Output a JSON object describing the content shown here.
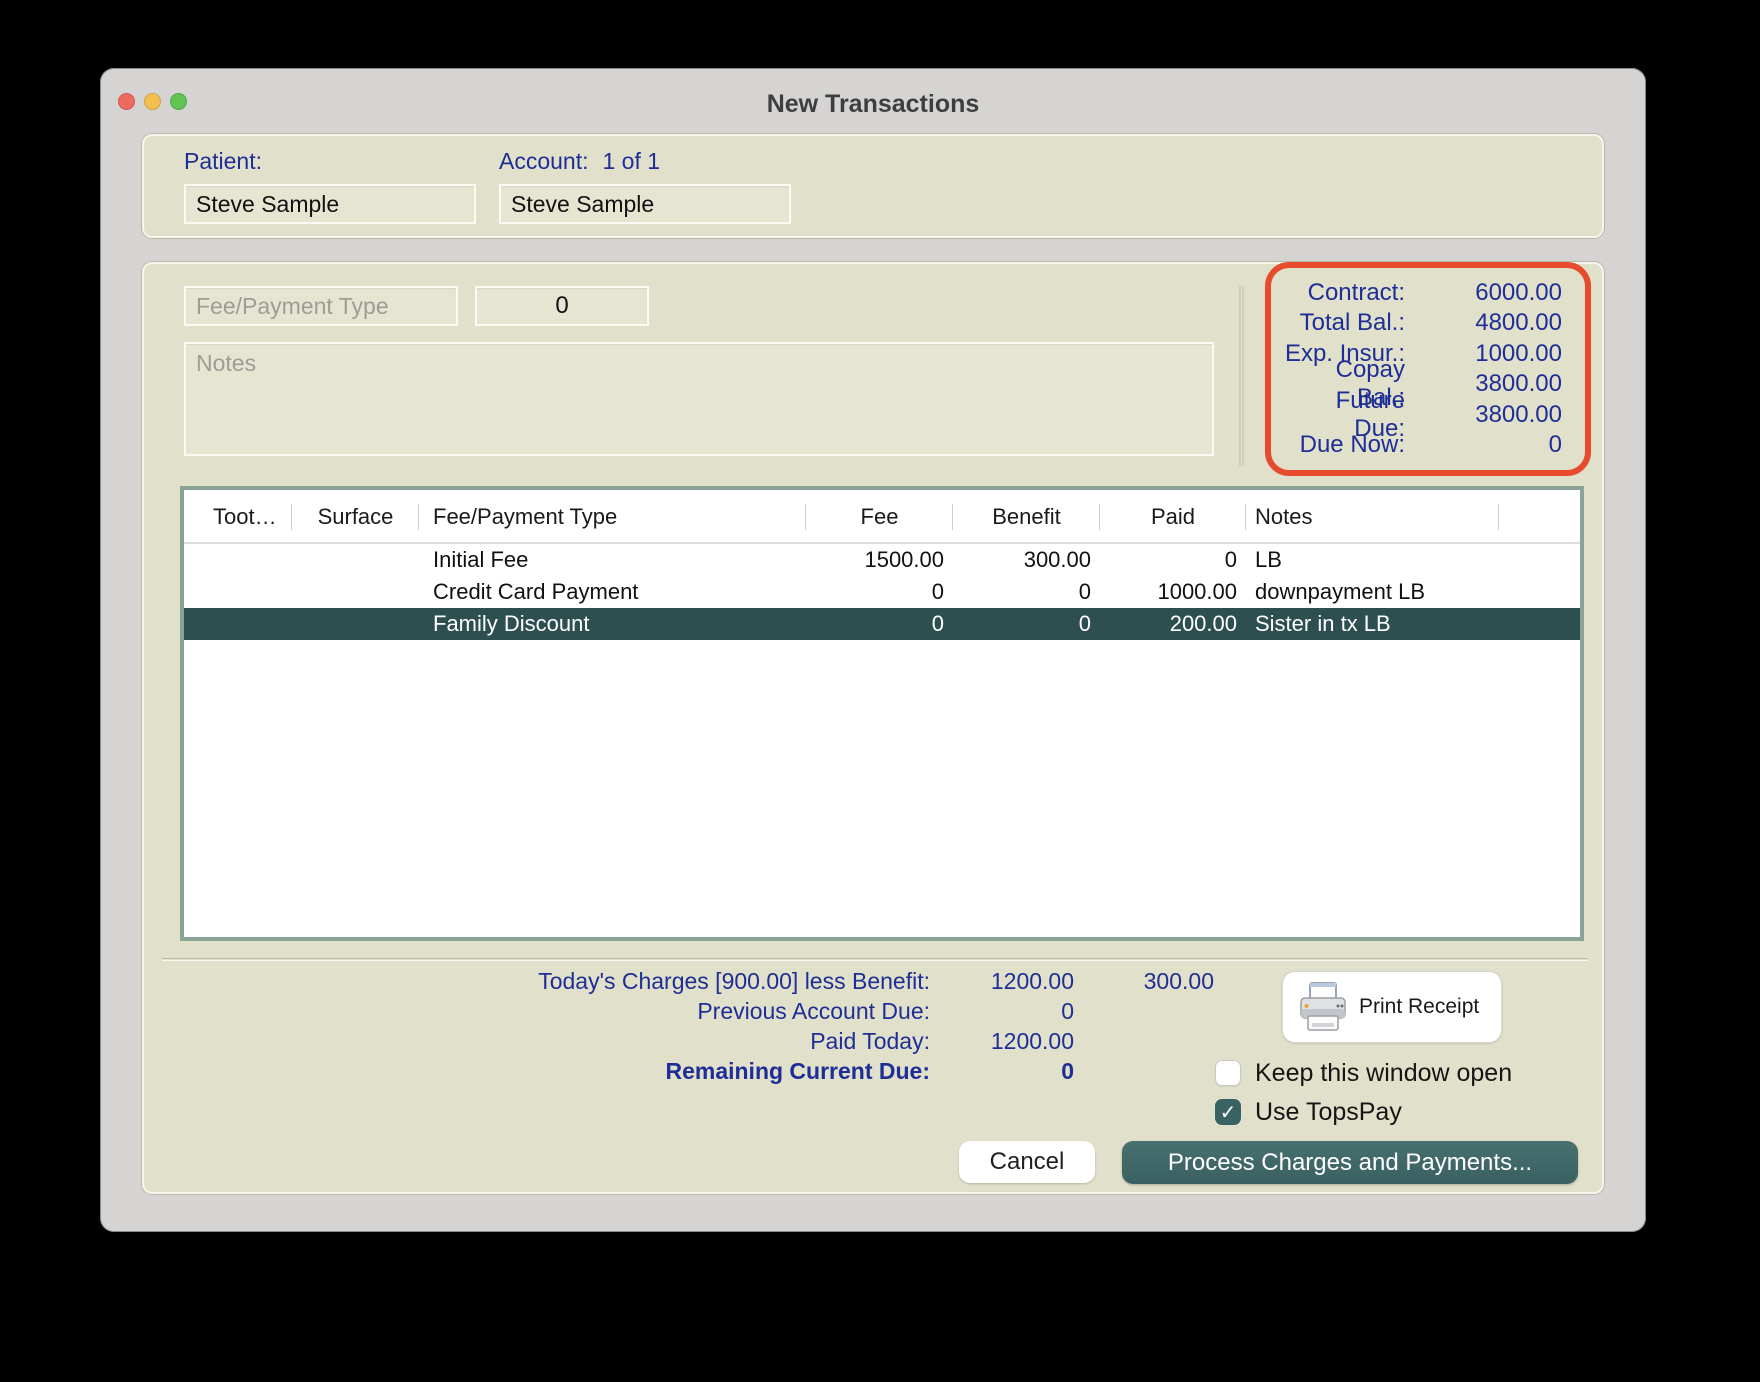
{
  "window": {
    "title": "New Transactions"
  },
  "patient_section": {
    "patient_label": "Patient:",
    "patient_value": "Steve Sample",
    "account_label": "Account:",
    "account_value": "1 of 1",
    "account_name": "Steve Sample"
  },
  "entry": {
    "fee_type_placeholder": "Fee/Payment Type",
    "amount_value": "0",
    "notes_placeholder": "Notes"
  },
  "balances": {
    "rows": [
      {
        "label": "Contract:",
        "value": "6000.00"
      },
      {
        "label": "Total Bal.:",
        "value": "4800.00"
      },
      {
        "label": "Exp. Insur.:",
        "value": "1000.00"
      },
      {
        "label": "Copay Bal.:",
        "value": "3800.00"
      },
      {
        "label": "Future Due:",
        "value": "3800.00"
      },
      {
        "label": "Due Now:",
        "value": "0"
      }
    ]
  },
  "table": {
    "headers": {
      "tooth": "Toot…",
      "surface": "Surface",
      "type": "Fee/Payment Type",
      "fee": "Fee",
      "benefit": "Benefit",
      "paid": "Paid",
      "notes": "Notes"
    },
    "rows": [
      {
        "tooth": "",
        "surface": "",
        "type": "Initial Fee",
        "fee": "1500.00",
        "benefit": "300.00",
        "paid": "0",
        "notes": "LB",
        "selected": false
      },
      {
        "tooth": "",
        "surface": "",
        "type": "Credit Card Payment",
        "fee": "0",
        "benefit": "0",
        "paid": "1000.00",
        "notes": "downpayment LB",
        "selected": false
      },
      {
        "tooth": "",
        "surface": "",
        "type": "Family Discount",
        "fee": "0",
        "benefit": "0",
        "paid": "200.00",
        "notes": "Sister in tx LB",
        "selected": true
      }
    ]
  },
  "summary": {
    "rows": [
      {
        "label": "Today's Charges [900.00] less Benefit:",
        "value": "1200.00",
        "value2": "300.00",
        "bold": false
      },
      {
        "label": "Previous Account Due:",
        "value": "0",
        "value2": "",
        "bold": false
      },
      {
        "label": "Paid Today:",
        "value": "1200.00",
        "value2": "",
        "bold": false
      },
      {
        "label": "Remaining Current Due:",
        "value": "0",
        "value2": "",
        "bold": true
      }
    ]
  },
  "actions": {
    "print_receipt_label": "Print Receipt",
    "keep_open_label": "Keep this window open",
    "keep_open_checked": false,
    "use_topspay_label": "Use TopsPay",
    "use_topspay_checked": true,
    "check_glyph": "✓",
    "cancel_label": "Cancel",
    "process_label": "Process Charges and Payments..."
  },
  "colors": {
    "accent_blue": "#1e2e96",
    "button_teal": "#406667",
    "selected_row_teal": "#2e4f50",
    "highlight_red": "#e64b2d",
    "table_frame_sage": "#8aa396",
    "panel_beige": "#e1e0cb"
  }
}
